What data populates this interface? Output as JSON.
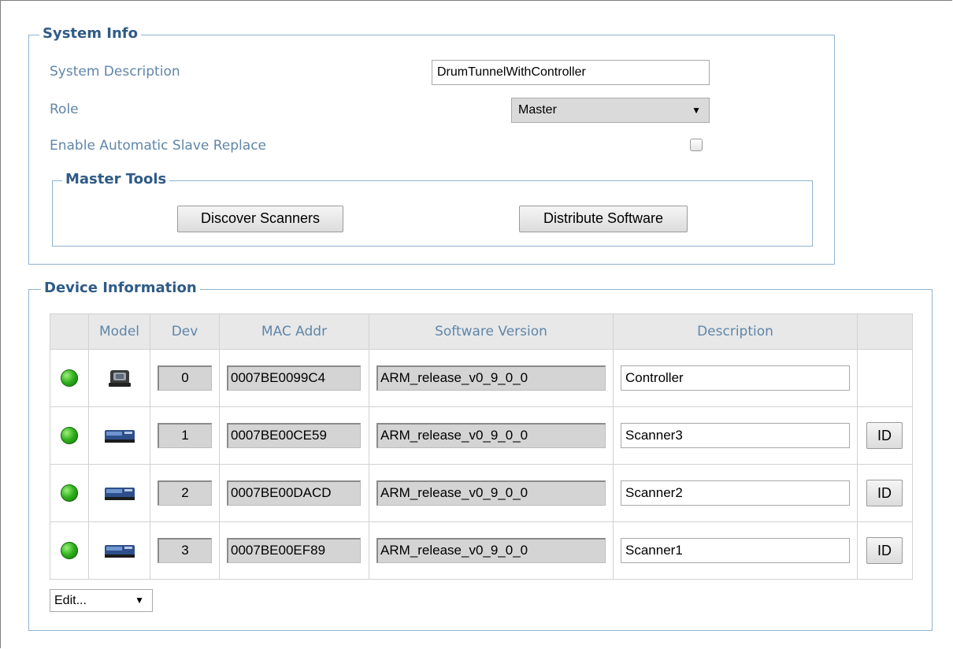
{
  "system_info": {
    "legend": "System Info",
    "description_label": "System Description",
    "description_value": "DrumTunnelWithController",
    "role_label": "Role",
    "role_value": "Master",
    "auto_replace_label": "Enable Automatic Slave Replace",
    "auto_replace_checked": false
  },
  "master_tools": {
    "legend": "Master Tools",
    "discover_label": "Discover Scanners",
    "distribute_label": "Distribute Software"
  },
  "device_info": {
    "legend": "Device Information",
    "columns": [
      "",
      "Model",
      "Dev",
      "MAC Addr",
      "Software Version",
      "Description",
      ""
    ],
    "rows": [
      {
        "status": "green",
        "model_icon": "controller-icon",
        "dev": "0",
        "mac": "0007BE0099C4",
        "software": "ARM_release_v0_9_0_0",
        "description": "Controller",
        "id_button": ""
      },
      {
        "status": "green",
        "model_icon": "scanner-icon",
        "dev": "1",
        "mac": "0007BE00CE59",
        "software": "ARM_release_v0_9_0_0",
        "description": "Scanner3",
        "id_button": "ID"
      },
      {
        "status": "green",
        "model_icon": "scanner-icon",
        "dev": "2",
        "mac": "0007BE00DACD",
        "software": "ARM_release_v0_9_0_0",
        "description": "Scanner2",
        "id_button": "ID"
      },
      {
        "status": "green",
        "model_icon": "scanner-icon",
        "dev": "3",
        "mac": "0007BE00EF89",
        "software": "ARM_release_v0_9_0_0",
        "description": "Scanner1",
        "id_button": "ID"
      }
    ],
    "edit_select_value": "Edit..."
  },
  "colors": {
    "legend_text": "#2f5b86",
    "label_text": "#5f86a9",
    "fieldset_border": "#8fb3cf",
    "status_green": "#2fb01d"
  }
}
